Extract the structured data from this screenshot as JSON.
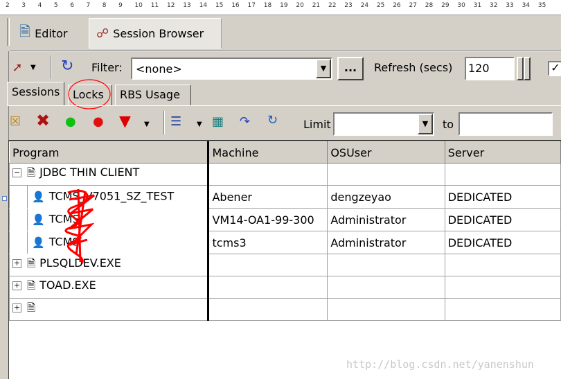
{
  "ruler": {
    "numbers": [
      "2",
      "3",
      "4",
      "5",
      "6",
      "7",
      "8",
      "9",
      "10",
      "11",
      "12",
      "13",
      "14",
      "15",
      "16",
      "17",
      "18",
      "19",
      "20",
      "21",
      "22",
      "23",
      "24",
      "25",
      "26",
      "27",
      "28",
      "29",
      "30",
      "31",
      "32",
      "33",
      "34",
      "35"
    ]
  },
  "main_tabs": [
    {
      "label": "Editor",
      "icon": "editor-icon"
    },
    {
      "label": "Session Browser",
      "icon": "session-browser-icon",
      "active": true
    }
  ],
  "toolbar": {
    "filter_label": "Filter:",
    "filter_value": "<none>",
    "ellipsis": "...",
    "refresh_label": "Refresh (secs)",
    "refresh_value": "120",
    "auto_refresh_checked": true
  },
  "sub_tabs": [
    {
      "label": "Sessions",
      "active": true
    },
    {
      "label": "Locks",
      "highlighted": true
    },
    {
      "label": "RBS Usage"
    }
  ],
  "toolbar2": {
    "limit_label": "Limit",
    "limit_value": "",
    "to_label": "to",
    "to_value": ""
  },
  "grid": {
    "columns": [
      "Program",
      "Machine",
      "OSUser",
      "Server"
    ],
    "rows": [
      {
        "level": 0,
        "expander": "−",
        "program": "JDBC THIN CLIENT",
        "machine": "",
        "osuser": "",
        "server": ""
      },
      {
        "level": 1,
        "program": "TCMS_V7051_SZ_TEST",
        "machine": "Abener",
        "osuser": "dengzeyao",
        "server": "DEDICATED"
      },
      {
        "level": 1,
        "program": "TCMS",
        "machine": "VM14-OA1-99-300",
        "osuser": "Administrator",
        "server": "DEDICATED"
      },
      {
        "level": 1,
        "program": "TCMS",
        "machine": "tcms3",
        "osuser": "Administrator",
        "server": "DEDICATED"
      },
      {
        "level": 0,
        "expander": "+",
        "program": "PLSQLDEV.EXE",
        "machine": "",
        "osuser": "",
        "server": ""
      },
      {
        "level": 0,
        "expander": "+",
        "program": "TOAD.EXE",
        "machine": "",
        "osuser": "",
        "server": ""
      },
      {
        "level": 0,
        "expander": "+",
        "program": "",
        "machine": "",
        "osuser": "",
        "server": ""
      }
    ]
  },
  "watermark": "http://blog.csdn.net/yanenshun",
  "colors": {
    "annotation": "#ff0000",
    "background": "#d4d0c8"
  }
}
